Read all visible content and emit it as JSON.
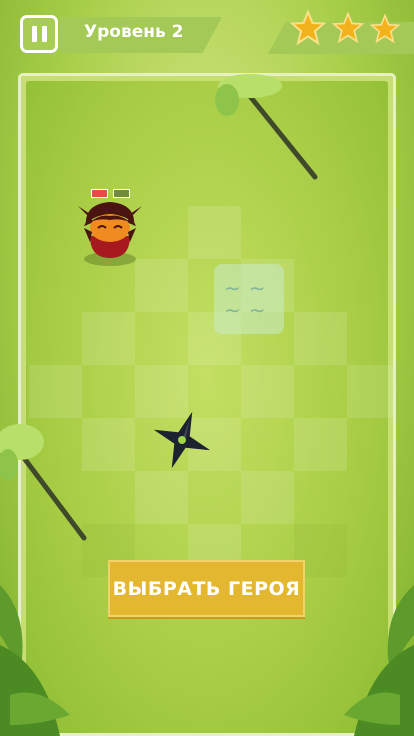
{
  "header": {
    "level_label": "Уровень 2",
    "stars_earned": 3,
    "stars_total": 3
  },
  "hero": {
    "health_segments": 2,
    "health_filled": 1
  },
  "actions": {
    "select_hero_label": "ВЫБРАТЬ ГЕРОЯ"
  },
  "colors": {
    "accent_button": "#e3b72f",
    "grass": "#a8cd45",
    "hp_red": "#e94b4b",
    "star": "#f2b21c"
  },
  "icons": [
    "pause-icon",
    "star-icon",
    "shuriken-icon",
    "water-icon",
    "palm-tree-icon"
  ]
}
